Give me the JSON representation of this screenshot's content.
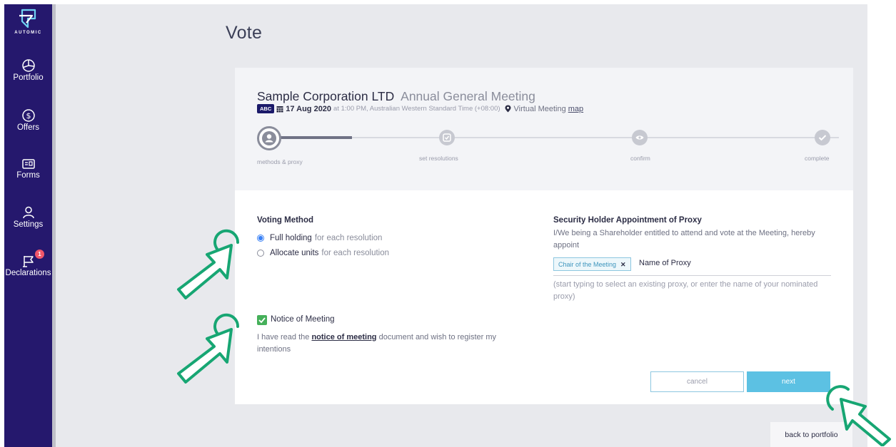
{
  "sidebar": {
    "logo_text": "AUTOMIC",
    "items": [
      {
        "label": "Portfolio",
        "icon": "pie-chart-icon"
      },
      {
        "label": "Offers",
        "icon": "dollar-circle-icon"
      },
      {
        "label": "Forms",
        "icon": "form-card-icon"
      },
      {
        "label": "Settings",
        "icon": "user-icon"
      },
      {
        "label": "Declarations",
        "icon": "flag-icon",
        "badge": "1"
      }
    ]
  },
  "page": {
    "title": "Vote",
    "back_label": "back to portfolio"
  },
  "meeting": {
    "company": "Sample Corporation LTD",
    "type": "Annual General Meeting",
    "ticker": "ABC",
    "date": "17 Aug 2020",
    "time": "at 1:00 PM, Australian Western Standard Time (+08:00)",
    "venue": "Virtual Meeting",
    "map_link": "map"
  },
  "steps": [
    {
      "label": "methods & proxy"
    },
    {
      "label": "set resolutions"
    },
    {
      "label": "confirm"
    },
    {
      "label": "complete"
    }
  ],
  "voting": {
    "heading": "Voting Method",
    "options": [
      {
        "strong": "Full holding",
        "rest": "for each resolution",
        "selected": true
      },
      {
        "strong": "Allocate units",
        "rest": "for each resolution",
        "selected": false
      }
    ]
  },
  "notice": {
    "label": "Notice of Meeting",
    "text_before": "I have read the",
    "link": "notice of meeting",
    "text_after": "document and wish to register my intentions",
    "checked": true
  },
  "proxy": {
    "heading": "Security Holder Appointment of Proxy",
    "description": "I/We being a Shareholder entitled to attend and vote at the Meeting, hereby appoint",
    "tag": "Chair of the Meeting",
    "input_value": "Name of Proxy",
    "hint": "(start typing to select an existing proxy, or enter the name of your nominated proxy)"
  },
  "actions": {
    "cancel": "cancel",
    "next": "next"
  },
  "colors": {
    "sidebar": "#25186d",
    "accent": "#5cc1e3",
    "check": "#45b05a",
    "annotation": "#17a673",
    "badge": "#f0566a"
  }
}
